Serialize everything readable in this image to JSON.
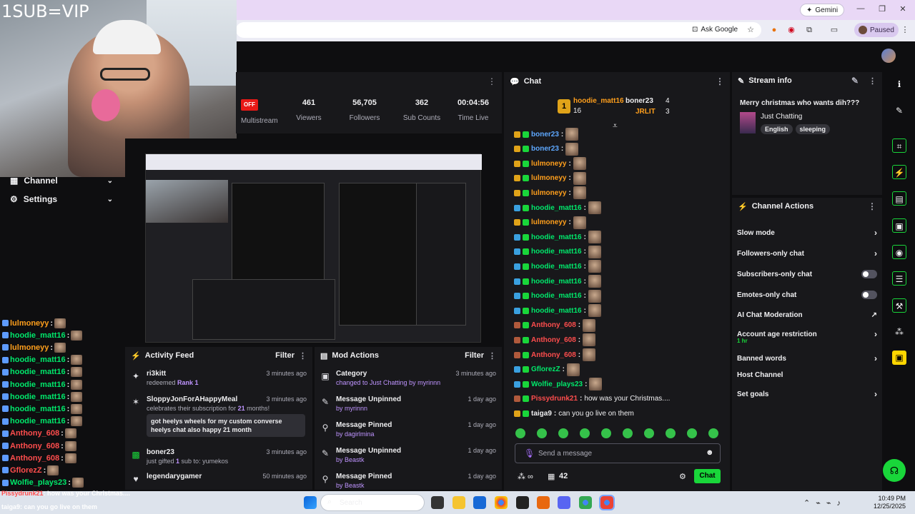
{
  "browser": {
    "gemini_label": "Gemini",
    "ask_google_label": "Ask Google",
    "paused_label": "Paused"
  },
  "webcam": {
    "overlay_text": "1SUB=VIP"
  },
  "sidebar": {
    "items": [
      {
        "label": "Channel"
      },
      {
        "label": "Settings"
      }
    ],
    "chat_lines": [
      {
        "user": "lulmoneyy",
        "color": "#ff9f1c"
      },
      {
        "user": "hoodie_matt16",
        "color": "#00e86b"
      },
      {
        "user": "lulmoneyy",
        "color": "#ff9f1c"
      },
      {
        "user": "hoodie_matt16",
        "color": "#00e86b"
      },
      {
        "user": "hoodie_matt16",
        "color": "#00e86b"
      },
      {
        "user": "hoodie_matt16",
        "color": "#00e86b"
      },
      {
        "user": "hoodie_matt16",
        "color": "#00e86b"
      },
      {
        "user": "hoodie_matt16",
        "color": "#00e86b"
      },
      {
        "user": "hoodie_matt16",
        "color": "#00e86b"
      },
      {
        "user": "Anthony_608",
        "color": "#ff4d4d"
      },
      {
        "user": "Anthony_608",
        "color": "#ff4d4d"
      },
      {
        "user": "Anthony_608",
        "color": "#ff4d4d"
      },
      {
        "user": "GflorezZ",
        "color": "#ff4d4d"
      },
      {
        "user": "Wolfie_plays23",
        "color": "#00e86b"
      }
    ],
    "overlay_lines": [
      {
        "user": "Pissydrunk21",
        "text": ": how was your Christmas...."
      },
      {
        "user": "taiga9",
        "text": ": can you go live on them"
      }
    ]
  },
  "stats": {
    "status_badge": "OFF",
    "multistream_label": "Multistream",
    "items": [
      {
        "value": "461",
        "label": "Viewers"
      },
      {
        "value": "56,705",
        "label": "Followers"
      },
      {
        "value": "362",
        "label": "Sub Counts"
      },
      {
        "value": "00:04:56",
        "label": "Time Live"
      }
    ]
  },
  "activity_feed": {
    "title": "Activity Feed",
    "filter_label": "Filter",
    "items": [
      {
        "icon": "sparkle-icon",
        "title": "ri3kitt",
        "time": "3 minutes ago",
        "sub_prefix": "redeemed ",
        "sub_highlight": "Rank 1",
        "sub_suffix": ""
      },
      {
        "icon": "star-icon",
        "title": "SloppyJonForAHappyMeal",
        "time": "3 minutes ago",
        "sub_prefix": "celebrates their subscription for ",
        "sub_highlight": "21",
        "sub_suffix": " months!",
        "message": "got heelys wheels for my custom converse heelys chat also happy 21 month"
      },
      {
        "icon": "gift-icon",
        "title": "boner23",
        "time": "3 minutes ago",
        "sub_prefix": "just gifted ",
        "sub_highlight": "1",
        "sub_suffix": " sub to: yumekos"
      },
      {
        "icon": "heart-icon",
        "title": "legendarygamer",
        "time": "50 minutes ago",
        "sub_prefix": "",
        "sub_highlight": "",
        "sub_suffix": ""
      }
    ]
  },
  "mod_actions": {
    "title": "Mod Actions",
    "filter_label": "Filter",
    "items": [
      {
        "title": "Category",
        "time": "3 minutes ago",
        "sub": "changed to Just Chatting by myrinnn"
      },
      {
        "title": "Message Unpinned",
        "time": "1 day ago",
        "sub": "by myrinnn"
      },
      {
        "title": "Message Pinned",
        "time": "1 day ago",
        "sub": "by dagirlmina"
      },
      {
        "title": "Message Unpinned",
        "time": "1 day ago",
        "sub": "by Beastk"
      },
      {
        "title": "Message Pinned",
        "time": "1 day ago",
        "sub": "by Beastk"
      }
    ]
  },
  "chat": {
    "title": "Chat",
    "leaderboard": {
      "first_user": "hoodie_matt16",
      "first_count": "16",
      "second_user": "boner23",
      "second_count": "4",
      "third_user": "JRLIT",
      "third_count": "3"
    },
    "messages": [
      {
        "user": "boner23",
        "color": "#5ea8ff",
        "text": ""
      },
      {
        "user": "boner23",
        "color": "#5ea8ff",
        "text": ""
      },
      {
        "user": "lulmoneyy",
        "color": "#ff9f1c",
        "text": ""
      },
      {
        "user": "lulmoneyy",
        "color": "#ff9f1c",
        "text": ""
      },
      {
        "user": "lulmoneyy",
        "color": "#ff9f1c",
        "text": ""
      },
      {
        "user": "hoodie_matt16",
        "color": "#00e86b",
        "text": ""
      },
      {
        "user": "lulmoneyy",
        "color": "#ff9f1c",
        "text": ""
      },
      {
        "user": "hoodie_matt16",
        "color": "#00e86b",
        "text": ""
      },
      {
        "user": "hoodie_matt16",
        "color": "#00e86b",
        "text": ""
      },
      {
        "user": "hoodie_matt16",
        "color": "#00e86b",
        "text": ""
      },
      {
        "user": "hoodie_matt16",
        "color": "#00e86b",
        "text": ""
      },
      {
        "user": "hoodie_matt16",
        "color": "#00e86b",
        "text": ""
      },
      {
        "user": "hoodie_matt16",
        "color": "#00e86b",
        "text": ""
      },
      {
        "user": "Anthony_608",
        "color": "#ff4d4d",
        "text": ""
      },
      {
        "user": "Anthony_608",
        "color": "#ff4d4d",
        "text": ""
      },
      {
        "user": "Anthony_608",
        "color": "#ff4d4d",
        "text": ""
      },
      {
        "user": "GflorezZ",
        "color": "#00e86b",
        "text": ""
      },
      {
        "user": "Wolfie_plays23",
        "color": "#00e86b",
        "text": ""
      },
      {
        "user": "Pissydrunk21",
        "color": "#ff4d4d",
        "text": "how was your Christmas...."
      },
      {
        "user": "taiga9",
        "color": "#efeff1",
        "text": "can you go live on them"
      }
    ],
    "input_placeholder": "Send a message",
    "points_value": "42",
    "send_label": "Chat"
  },
  "stream_info": {
    "title": "Stream info",
    "stream_title": "Merry christmas who wants dih???",
    "category": "Just Chatting",
    "tags": [
      "English",
      "sleeping"
    ]
  },
  "channel_actions": {
    "title": "Channel Actions",
    "items": [
      {
        "label": "Slow mode",
        "control": "arrow",
        "sub": ""
      },
      {
        "label": "Followers-only chat",
        "control": "arrow",
        "sub": ""
      },
      {
        "label": "Subscribers-only chat",
        "control": "toggle",
        "sub": ""
      },
      {
        "label": "Emotes-only chat",
        "control": "toggle",
        "sub": ""
      },
      {
        "label": "AI Chat Moderation",
        "control": "external",
        "sub": ""
      },
      {
        "label": "Account age restriction",
        "control": "arrow",
        "sub": "1 hr"
      },
      {
        "label": "Banned words",
        "control": "arrow",
        "sub": ""
      },
      {
        "label": "Host Channel",
        "control": "none",
        "sub": ""
      },
      {
        "label": "Set goals",
        "control": "arrow",
        "sub": ""
      }
    ]
  },
  "taskbar": {
    "search_label": "Search",
    "time": "10:49 PM",
    "date": "12/25/2025"
  }
}
